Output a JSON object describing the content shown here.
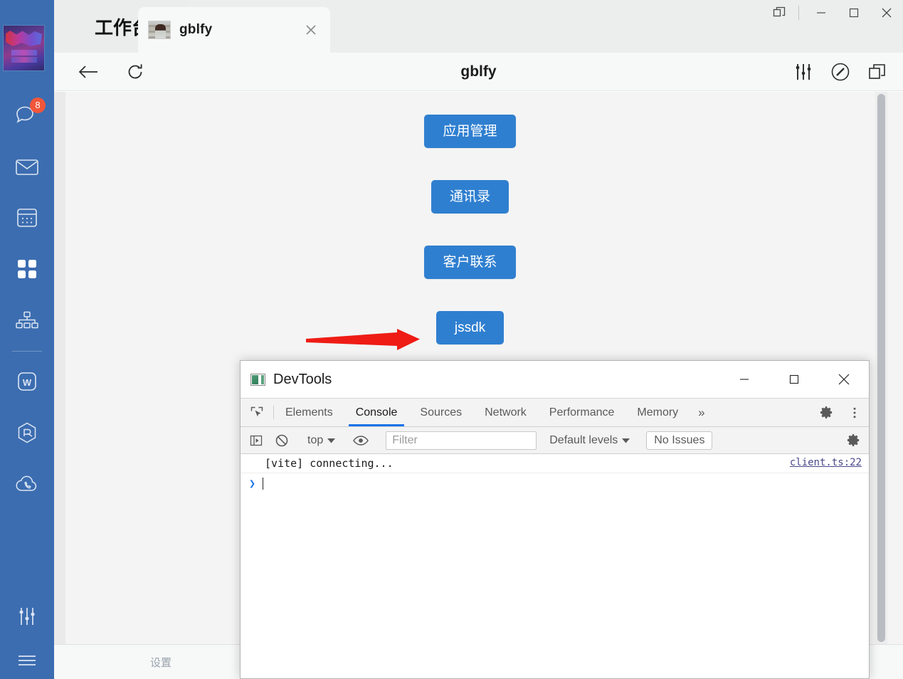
{
  "rail": {
    "avatar_name": "user-avatar",
    "items": [
      {
        "icon": "chat-icon",
        "badge": "8"
      },
      {
        "icon": "mail-icon",
        "badge": ""
      },
      {
        "icon": "calendar-icon",
        "badge": ""
      },
      {
        "icon": "apps-grid-icon",
        "badge": ""
      },
      {
        "icon": "org-chart-icon",
        "badge": ""
      },
      {
        "icon": "wps-w-icon",
        "badge": ""
      },
      {
        "icon": "cube-icon",
        "badge": ""
      },
      {
        "icon": "cloud-phone-icon",
        "badge": ""
      }
    ],
    "bottom_items": [
      {
        "icon": "sliders-icon"
      },
      {
        "icon": "menu-lines-icon"
      }
    ],
    "accent": "#3c6db0"
  },
  "titlebar": {
    "workbench_label": "工作台",
    "tab": {
      "title": "gblfy",
      "close_label": "×"
    },
    "window_buttons": {
      "restore_split": "⧉",
      "minimize": "—",
      "maximize": "▢",
      "close": "✕"
    }
  },
  "navbar": {
    "back_label": "←",
    "refresh_label": "⟳",
    "title": "gblfy",
    "right_icons": [
      "sliders-icon",
      "compass-icon",
      "open-external-icon"
    ]
  },
  "content": {
    "buttons": [
      {
        "label": "应用管理",
        "name": "app-management-button"
      },
      {
        "label": "通讯录",
        "name": "contacts-button"
      },
      {
        "label": "客户联系",
        "name": "customer-contact-button"
      },
      {
        "label": "jssdk",
        "name": "jssdk-button"
      }
    ],
    "button_color": "#2f7fd0",
    "annotation_arrow_color": "#ee1c15"
  },
  "bottombar": {
    "label": "设置"
  },
  "devtools": {
    "title": "DevTools",
    "window_buttons": {
      "minimize": "—",
      "maximize": "▢",
      "close": "✕"
    },
    "tabs": [
      {
        "label": "Elements",
        "active": false
      },
      {
        "label": "Console",
        "active": true
      },
      {
        "label": "Sources",
        "active": false
      },
      {
        "label": "Network",
        "active": false
      },
      {
        "label": "Performance",
        "active": false
      },
      {
        "label": "Memory",
        "active": false
      }
    ],
    "more_tabs_label": "»",
    "console_bar": {
      "sidebar_toggle": "console-sidebar-icon",
      "clear_label": "clear-console-icon",
      "context": "top",
      "eye_label": "live-expression-icon",
      "filter_placeholder": "Filter",
      "filter_value": "",
      "levels": "Default levels",
      "issues": "No Issues"
    },
    "console": {
      "messages": [
        {
          "text": "[vite] connecting...",
          "source": "client.ts:22"
        }
      ],
      "prompt_chevron": "❯",
      "prompt_value": ""
    }
  }
}
